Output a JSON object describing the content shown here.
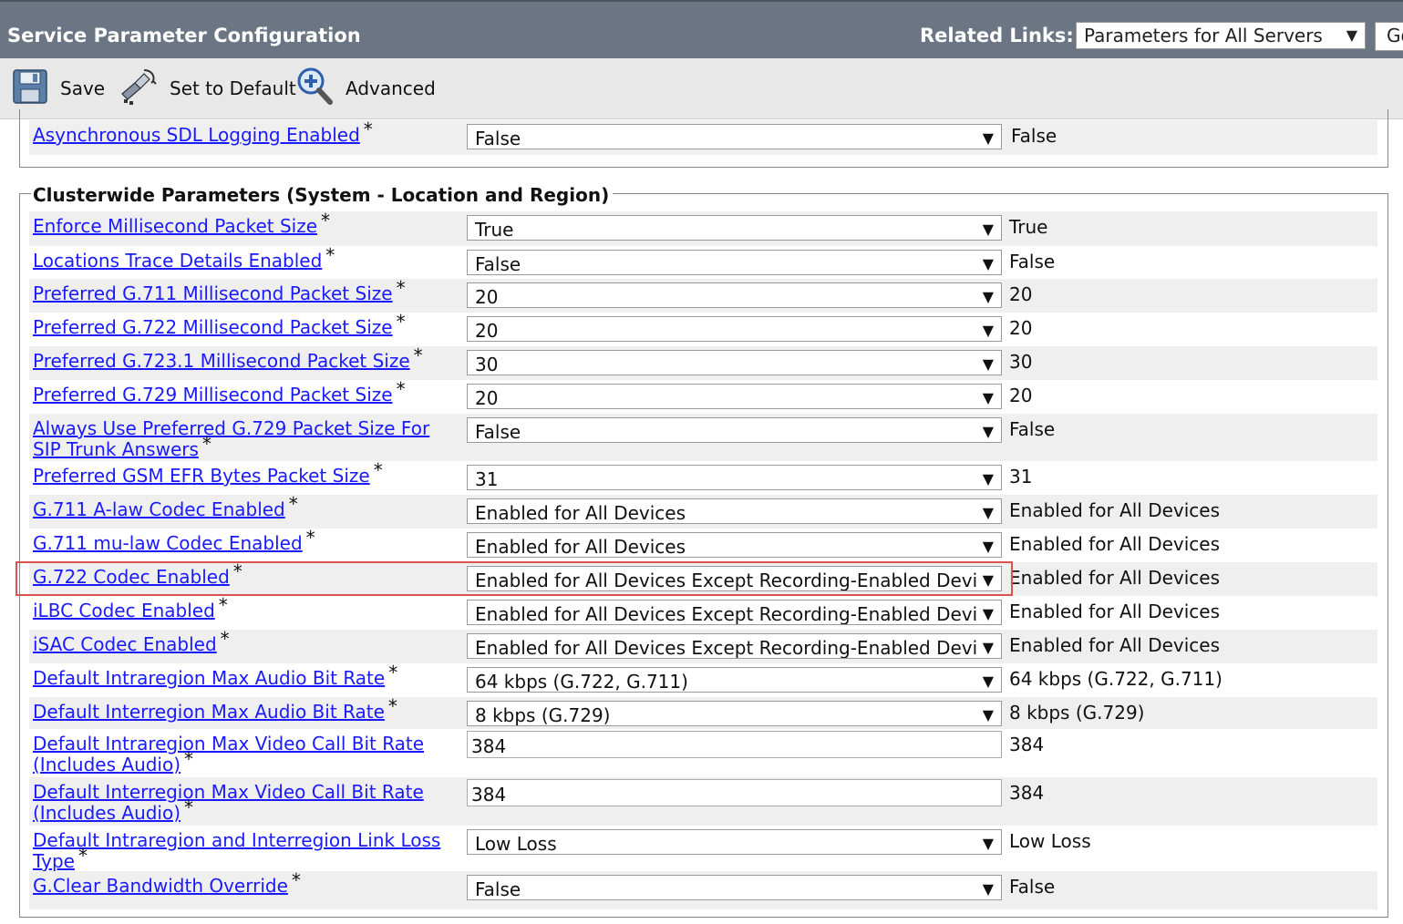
{
  "header": {
    "title": "Service Parameter Configuration",
    "related_links_label": "Related Links:",
    "related_links_value": "Parameters for All Servers",
    "go_label": "Go"
  },
  "toolbar": {
    "save_label": "Save",
    "set_default_label": "Set to Default",
    "advanced_label": "Advanced"
  },
  "top_panel": {
    "rows": [
      {
        "label": "Asynchronous SDL Logging Enabled",
        "value": "False",
        "default": "False"
      }
    ]
  },
  "location_panel": {
    "legend": "Clusterwide Parameters (System - Location and Region)",
    "rows": [
      {
        "label": "Enforce Millisecond Packet Size",
        "value": "True",
        "default": "True"
      },
      {
        "label": "Locations Trace Details Enabled",
        "value": "False",
        "default": "False"
      },
      {
        "label": "Preferred G.711 Millisecond Packet Size",
        "value": "20",
        "default": "20"
      },
      {
        "label": "Preferred G.722 Millisecond Packet Size",
        "value": "20",
        "default": "20"
      },
      {
        "label": "Preferred G.723.1 Millisecond Packet Size",
        "value": "30",
        "default": "30"
      },
      {
        "label": "Preferred G.729 Millisecond Packet Size",
        "value": "20",
        "default": "20"
      },
      {
        "label_line1": "Always Use Preferred G.729 Packet Size For",
        "label_line2": "SIP Trunk Answers",
        "value": "False",
        "default": "False"
      },
      {
        "label": "Preferred GSM EFR Bytes Packet Size",
        "value": "31",
        "default": "31"
      },
      {
        "label": "G.711 A-law Codec Enabled",
        "value": "Enabled for All Devices",
        "default": "Enabled for All Devices"
      },
      {
        "label": "G.711 mu-law Codec Enabled",
        "value": "Enabled for All Devices",
        "default": "Enabled for All Devices"
      },
      {
        "label": "G.722 Codec Enabled",
        "value": "Enabled for All Devices Except Recording-Enabled Devi",
        "default": "Enabled for All Devices"
      },
      {
        "label": "iLBC Codec Enabled",
        "value": "Enabled for All Devices Except Recording-Enabled Devi",
        "default": "Enabled for All Devices"
      },
      {
        "label": "iSAC Codec Enabled",
        "value": "Enabled for All Devices Except Recording-Enabled Devi",
        "default": "Enabled for All Devices"
      },
      {
        "label": "Default Intraregion Max Audio Bit Rate",
        "value": "64 kbps (G.722, G.711)",
        "default": "64 kbps (G.722, G.711)"
      },
      {
        "label": "Default Interregion Max Audio Bit Rate",
        "value": "8 kbps (G.729)",
        "default": "8 kbps (G.729)"
      },
      {
        "label_line1": "Default Intraregion Max Video Call Bit Rate",
        "label_line2": "(Includes Audio)",
        "value": "384",
        "default": "384"
      },
      {
        "label_line1": "Default Interregion Max Video Call Bit Rate",
        "label_line2": "(Includes Audio)",
        "value": "384",
        "default": "384"
      },
      {
        "label_line1": "Default Intraregion and Interregion Link Loss",
        "label_line2": "Type",
        "value": "Low Loss",
        "default": "Low Loss"
      },
      {
        "label": "G.Clear Bandwidth Override",
        "value": "False",
        "default": "False"
      }
    ]
  },
  "required_marker": "*",
  "highlight_color": "#d9534f",
  "link_color": "#1a1aff"
}
